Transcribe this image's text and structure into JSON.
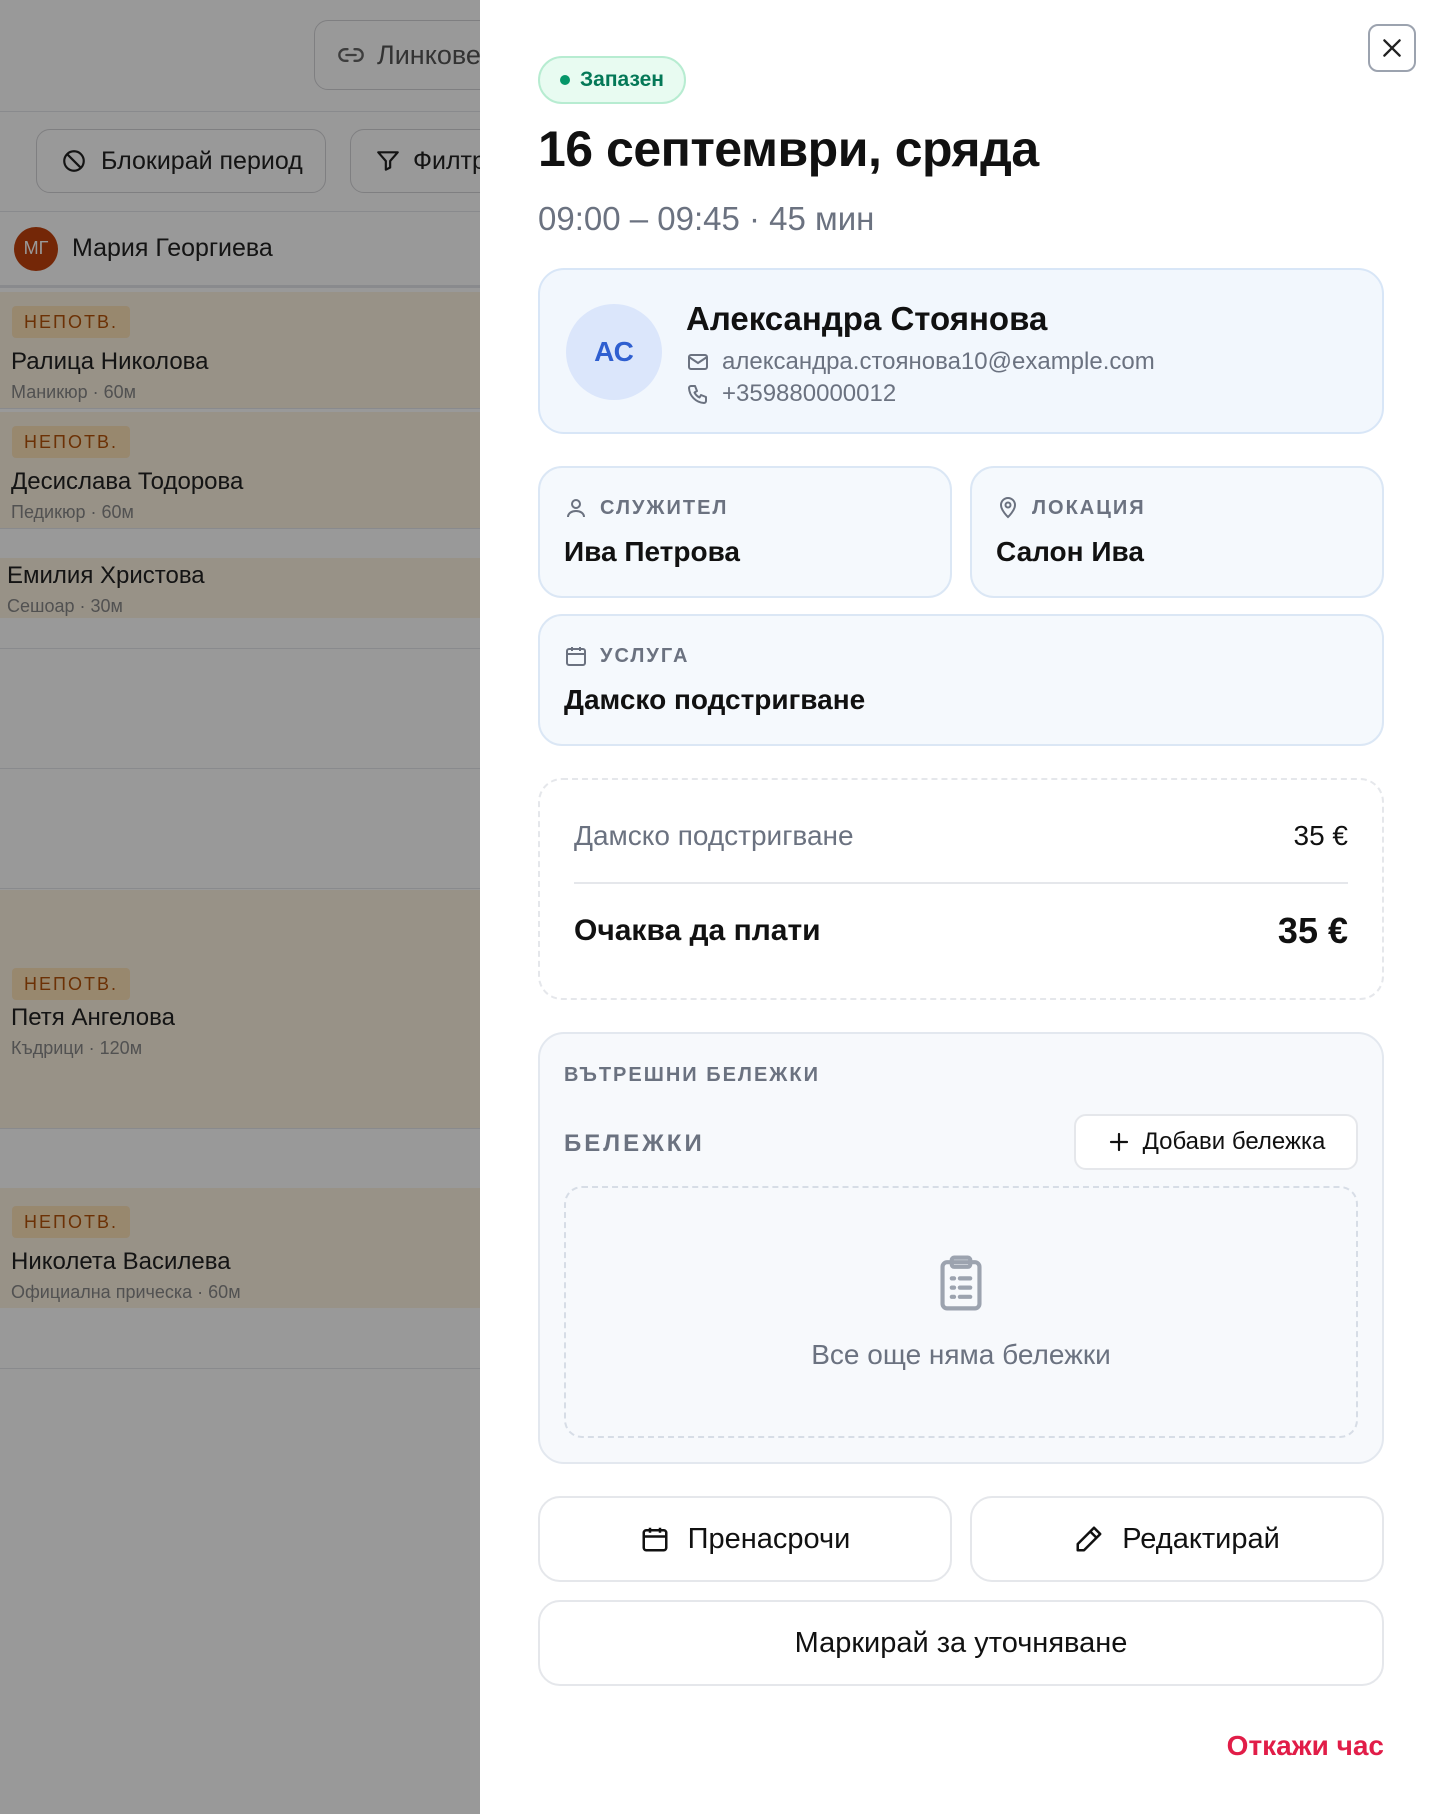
{
  "background": {
    "link_button": "Линкове",
    "block_button": "Блокирай период",
    "filter_button": "Филтри",
    "staff": {
      "initials": "МГ",
      "name": "Мария Георгиева"
    },
    "appointments": [
      {
        "badge": "НЕПОТВ.",
        "client": "Ралица Николова",
        "detail": "Маникюр · 60м"
      },
      {
        "badge": "НЕПОТВ.",
        "client": "Десислава Тодорова",
        "detail": "Педикюр · 60м"
      },
      {
        "badge": "",
        "client": "Емилия Христова",
        "detail": "Сешоар · 30м"
      },
      {
        "badge": "НЕПОТВ.",
        "client": "Петя Ангелова",
        "detail": "Къдрици · 120м"
      },
      {
        "badge": "НЕПОТВ.",
        "client": "Николета Василева",
        "detail": "Официална прическа · 60м"
      }
    ]
  },
  "drawer": {
    "status": "Запазен",
    "title": "16 септември, сряда",
    "time": "09:00 – 09:45 · 45 мин",
    "client": {
      "initials": "АС",
      "name": "Александра Стоянова",
      "email": "александра.стоянова10@example.com",
      "phone": "+359880000012"
    },
    "staff": {
      "label": "СЛУЖИТЕЛ",
      "value": "Ива Петрова"
    },
    "location": {
      "label": "ЛОКАЦИЯ",
      "value": "Салон Ива"
    },
    "service": {
      "label": "УСЛУГА",
      "value": "Дамско подстригване"
    },
    "price": {
      "item_name": "Дамско подстригване",
      "item_price": "35 €",
      "total_label": "Очаква да плати",
      "total_value": "35 €"
    },
    "notes": {
      "section_title": "ВЪТРЕШНИ БЕЛЕЖКИ",
      "subtitle": "БЕЛЕЖКИ",
      "add_button": "Добави бележка",
      "empty_text": "Все още няма бележки"
    },
    "actions": {
      "reschedule": "Пренасрочи",
      "edit": "Редактирай",
      "mark": "Маркирай за уточняване",
      "cancel": "Откажи час"
    }
  },
  "colors": {
    "accent_blue": "#2f5fd0",
    "status_green": "#047857",
    "danger": "#e11d48",
    "pending_badge": "#b45309"
  }
}
